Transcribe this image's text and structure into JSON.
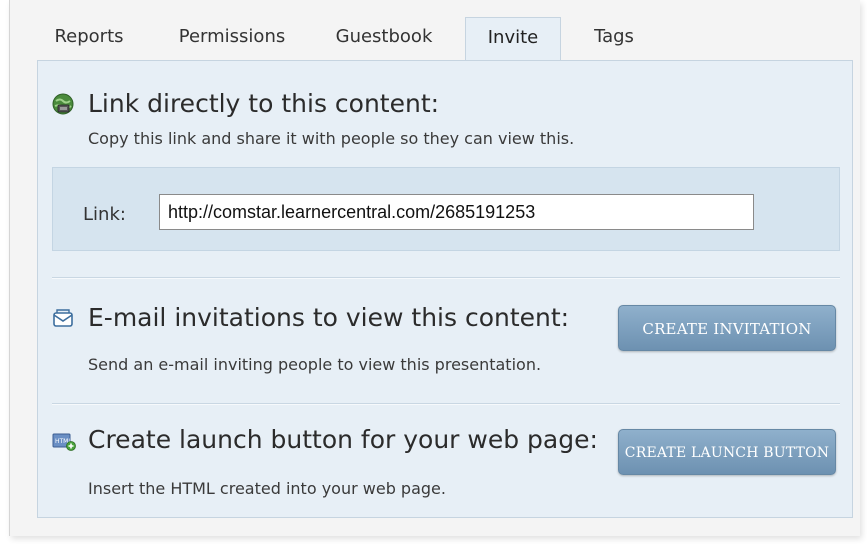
{
  "tabs": [
    {
      "label": "Reports",
      "active": false
    },
    {
      "label": "Permissions",
      "active": false
    },
    {
      "label": "Guestbook",
      "active": false
    },
    {
      "label": "Invite",
      "active": true
    },
    {
      "label": "Tags",
      "active": false
    }
  ],
  "link_section": {
    "title": "Link directly to this content:",
    "description": "Copy this link and share it with people so they can view this.",
    "link_label": "Link:",
    "link_value": "http://comstar.learnercentral.com/2685191253",
    "icon": "globe-icon"
  },
  "email_section": {
    "title": "E-mail invitations to view this content:",
    "description": "Send an e-mail inviting people to view this presentation.",
    "button_label": "CREATE INVITATION",
    "icon": "envelope-icon"
  },
  "launch_section": {
    "title": "Create launch button for your web page:",
    "description": "Insert the HTML created into your web page.",
    "button_label": "CREATE LAUNCH BUTTON",
    "icon": "html-icon"
  },
  "colors": {
    "panel_bg": "#e7eff6",
    "link_box_bg": "#d6e4ef",
    "button_bg": "#7a9dbd"
  }
}
